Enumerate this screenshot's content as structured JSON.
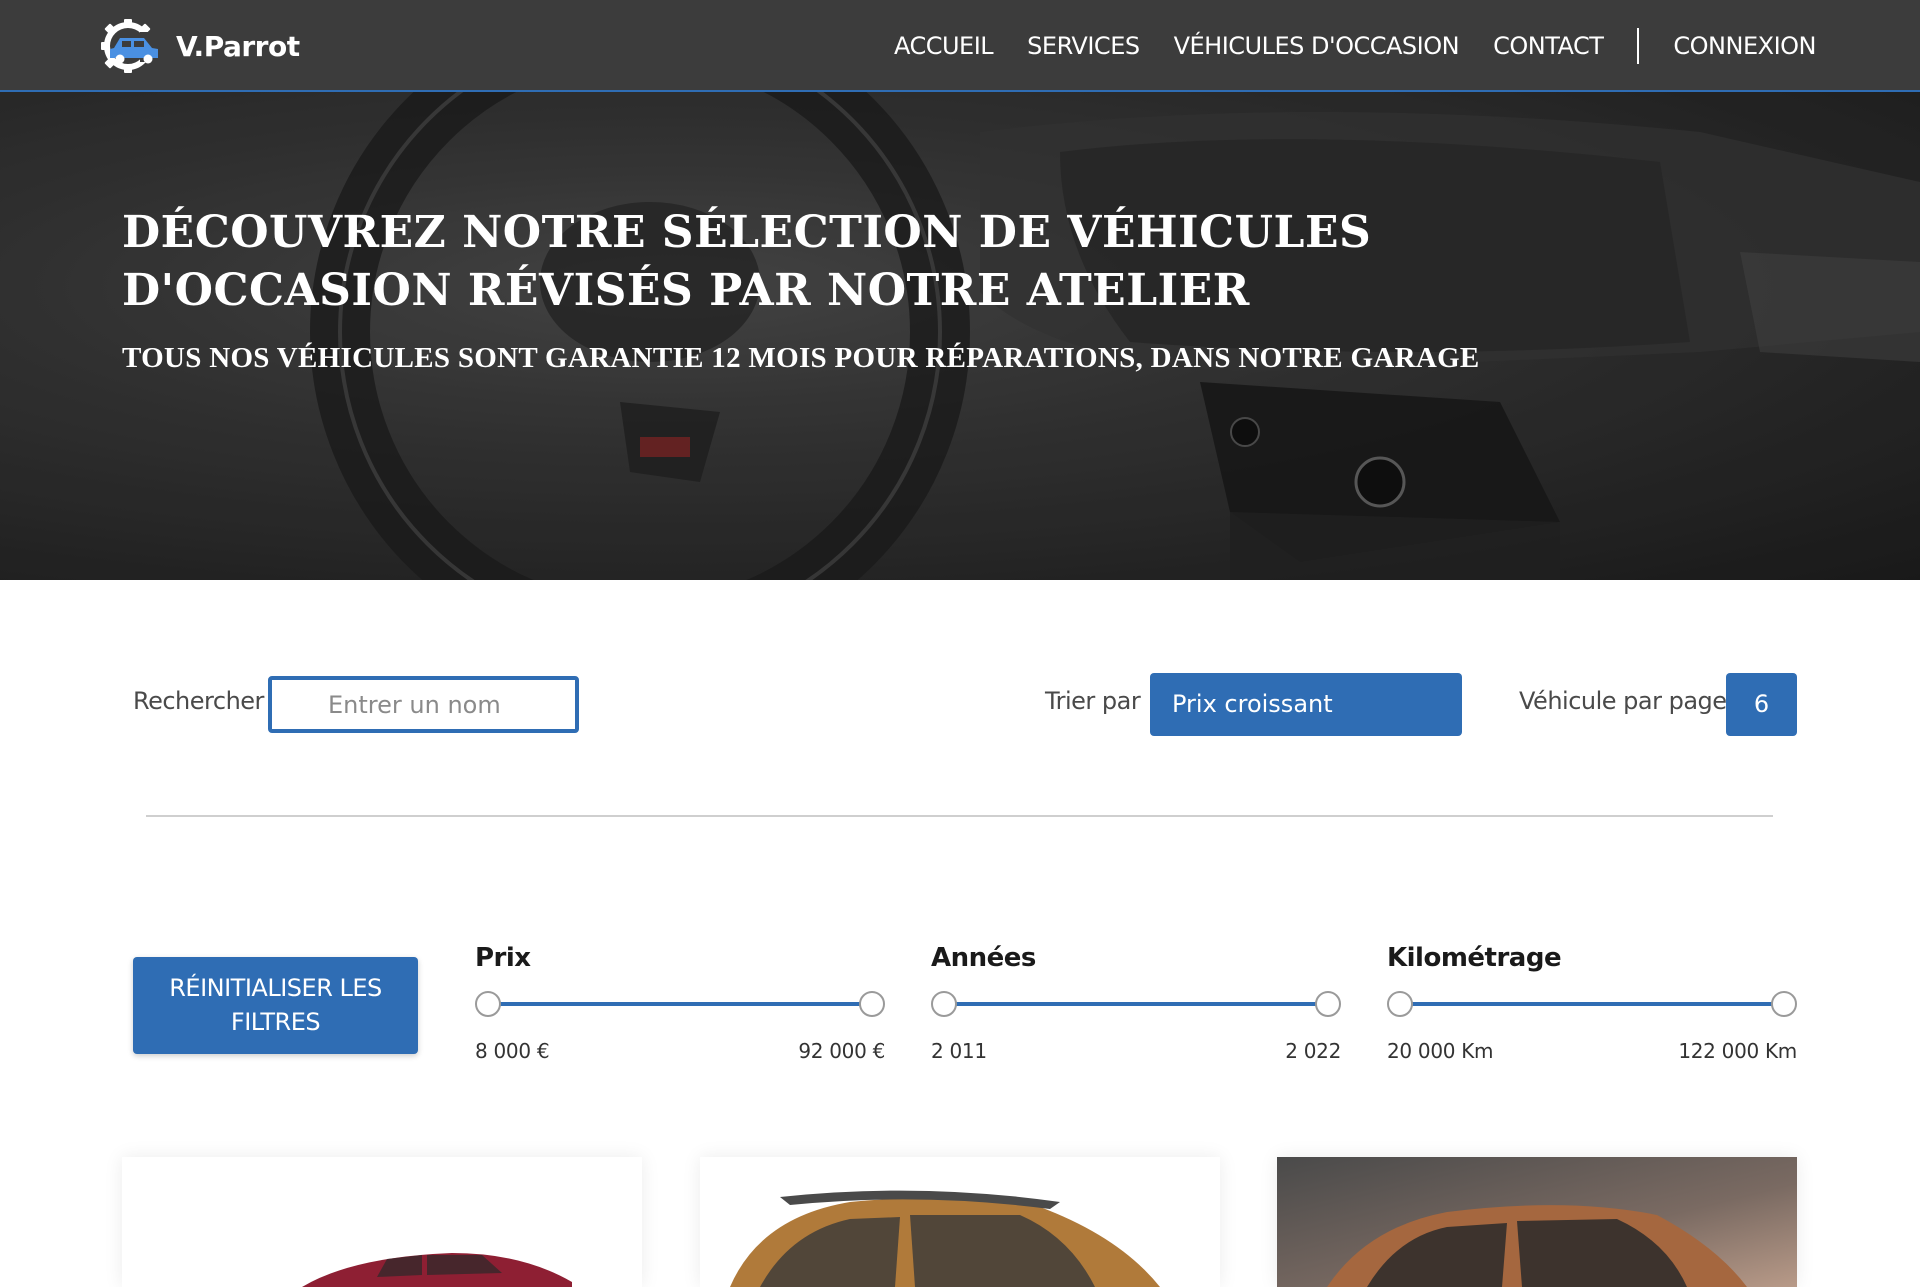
{
  "header": {
    "brand": "V.Parrot",
    "nav": [
      "ACCUEIL",
      "SERVICES",
      "VÉHICULES D'OCCASION",
      "CONTACT",
      "CONNEXION"
    ]
  },
  "hero": {
    "title_line1": "DÉCOUVREZ NOTRE SÉLECTION DE VÉHICULES",
    "title_line2": "D'OCCASION RÉVISÉS PAR NOTRE ATELIER",
    "subtitle": "TOUS NOS VÉHICULES SONT GARANTIE 12 MOIS POUR RÉPARATIONS, DANS NOTRE GARAGE"
  },
  "filters": {
    "search_label": "Rechercher",
    "search_placeholder": "Entrer un nom",
    "sort_label": "Trier par",
    "sort_value": "Prix croissant",
    "perpage_label": "Véhicule par page",
    "perpage_value": "6",
    "reset_line1": "RÉINITIALISER LES",
    "reset_line2": "FILTRES"
  },
  "ranges": {
    "price": {
      "title": "Prix",
      "min": "8 000 €",
      "max": "92 000 €"
    },
    "years": {
      "title": "Années",
      "min": "2 011",
      "max": "2 022"
    },
    "mileage": {
      "title": "Kilométrage",
      "min": "20 000 Km",
      "max": "122 000 Km"
    }
  },
  "colors": {
    "accent": "#2f6db4",
    "header_bg": "#3c3c3c"
  },
  "icons": {
    "logo": "gear-car-icon"
  }
}
